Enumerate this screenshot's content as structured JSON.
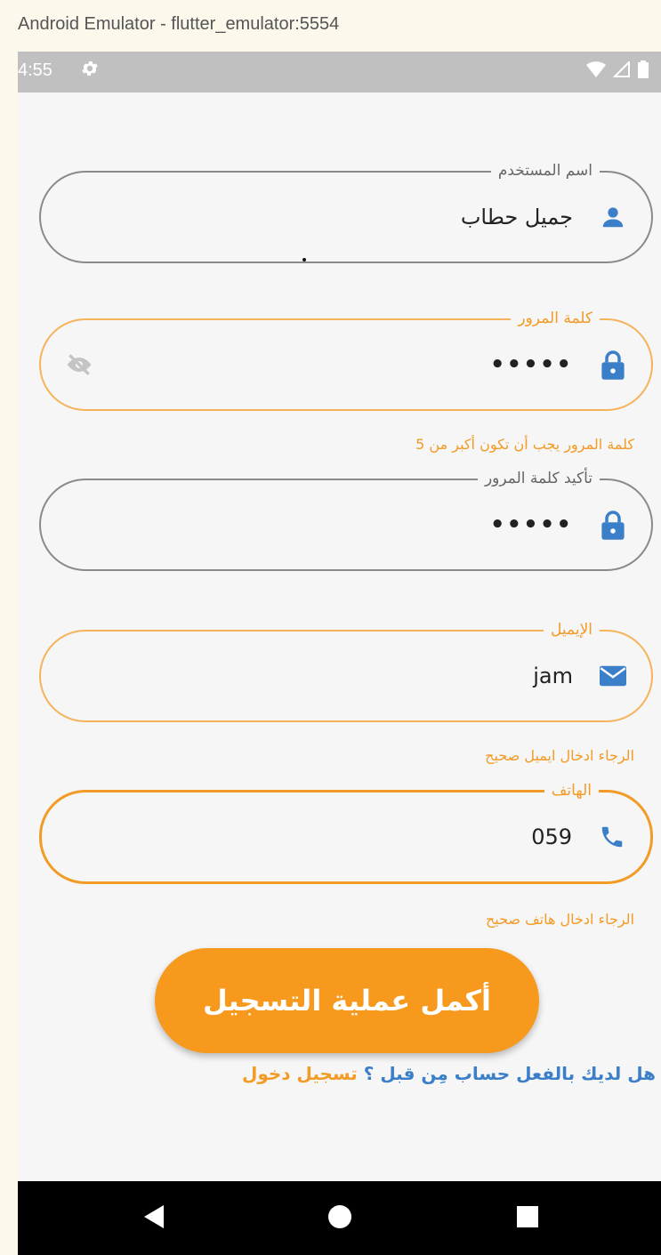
{
  "window": {
    "title": "Android Emulator - flutter_emulator:5554"
  },
  "status_bar": {
    "time": "4:55",
    "icons": [
      "gear-icon",
      "wifi-icon",
      "signal-icon",
      "battery-icon"
    ]
  },
  "form": {
    "username": {
      "label": "اسم المستخدم",
      "value": "جميل حطاب",
      "icon": "person-icon"
    },
    "password": {
      "label": "كلمة المرور",
      "value": "•••••",
      "icon": "lock-icon",
      "toggle_icon": "eye-off-icon",
      "error": "كلمة المرور يجب أن تكون أكبر من 5"
    },
    "confirm_password": {
      "label": "تأكيد كلمة المرور",
      "value": "•••••",
      "icon": "lock-icon"
    },
    "email": {
      "label": "الإيميل",
      "value": "jam",
      "icon": "mail-icon",
      "error": "الرجاء ادخال ايميل صحيح"
    },
    "phone": {
      "label": "الهاتف",
      "value": "059",
      "icon": "phone-icon",
      "error": "الرجاء ادخال هاتف صحيح"
    }
  },
  "submit": {
    "label": "أكمل عملية التسجيل"
  },
  "login_prompt": {
    "question": "هل لديك بالفعل حساب مِن قبل ؟",
    "link": "تسجيل دخول"
  },
  "colors": {
    "accent": "#f6991d",
    "icon_blue": "#3b7fc8",
    "error": "#f29b26",
    "border": "#8a8a8a"
  },
  "nav_bar": {
    "buttons": [
      "back-icon",
      "home-icon",
      "recents-icon"
    ]
  }
}
